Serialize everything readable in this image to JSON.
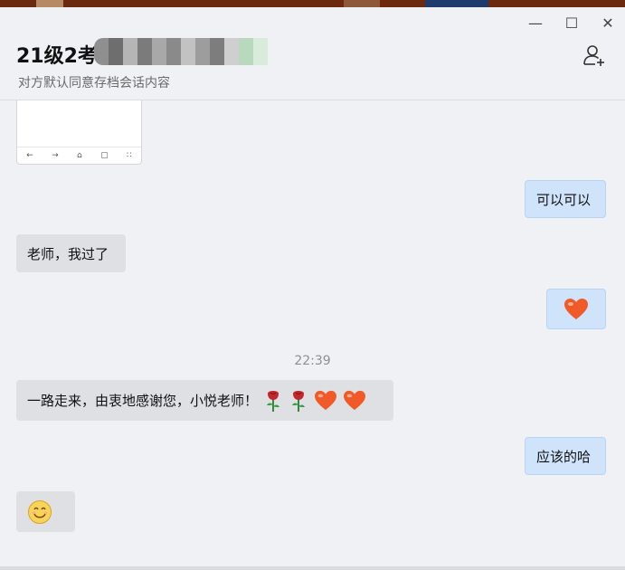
{
  "window": {
    "minimize_icon": "minimize-icon",
    "maximize_icon": "maximize-icon",
    "close_icon": "close-icon",
    "minimize_glyph": "—",
    "maximize_glyph": "☐",
    "close_glyph": "✕"
  },
  "header": {
    "title": "21级2考",
    "subtitle": "对方默认同意存档会话内容",
    "add_member_icon": "add-user-icon"
  },
  "image_preview": {
    "toolbar_glyphs": [
      "←",
      "→",
      "⌂",
      "▢",
      "∷"
    ]
  },
  "messages": [
    {
      "side": "out",
      "text": "可以可以"
    },
    {
      "side": "in",
      "text": "老师，我过了"
    },
    {
      "side": "out",
      "emoji": "❤"
    },
    {
      "timestamp": "22:39"
    },
    {
      "side": "in",
      "text": "一路走来，由衷地感谢您，小悦老师！",
      "emojis": [
        "🌹",
        "🌹",
        "❤",
        "❤"
      ]
    },
    {
      "side": "out",
      "text": "应该的哈"
    },
    {
      "side": "in",
      "emoji": "☺"
    }
  ],
  "colors": {
    "incoming_bubble": "#dfe0e4",
    "outgoing_bubble": "#cfe3fb",
    "heart": "#f05a28",
    "rose": "#c0282d"
  }
}
